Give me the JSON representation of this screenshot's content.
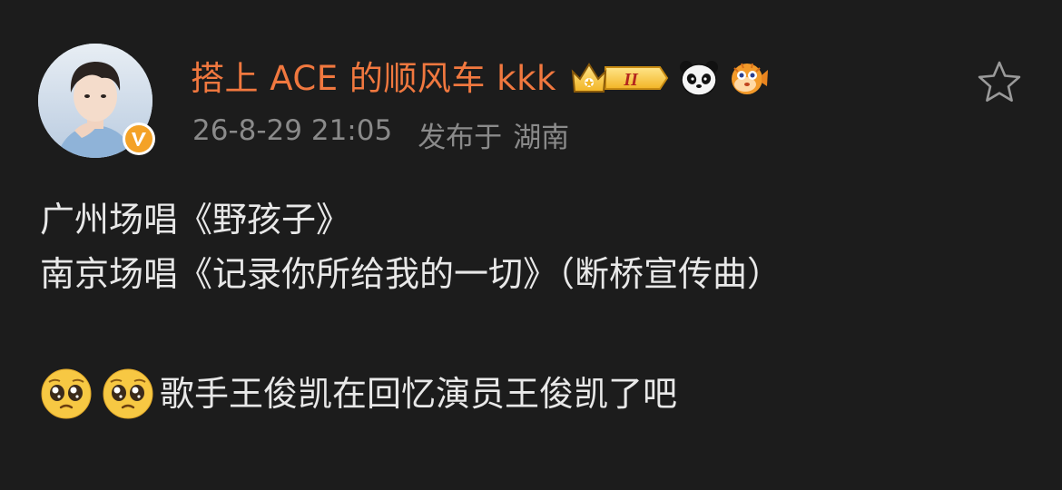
{
  "post": {
    "author": {
      "name": "搭上 ACE 的顺风车 kkk",
      "verified": true,
      "badges": [
        "crown-level-badge",
        "panda-icon",
        "pufferfish-icon"
      ],
      "level_text": "II"
    },
    "meta": {
      "timestamp": "26-8-29 21:05",
      "location_prefix": "发布于",
      "location": "湖南"
    },
    "content": {
      "line1": "广州场唱《野孩子》",
      "line2": "南京场唱《记录你所给我的一切》（断桥宣传曲）",
      "line3": "歌手王俊凯在回忆演员王俊凯了吧"
    },
    "actions": {
      "favorite_icon": "star-outline-icon"
    }
  },
  "colors": {
    "background": "#1c1c1c",
    "username": "#f1783f",
    "meta_text": "#8a8a8a",
    "body_text": "#e8e8e8"
  }
}
